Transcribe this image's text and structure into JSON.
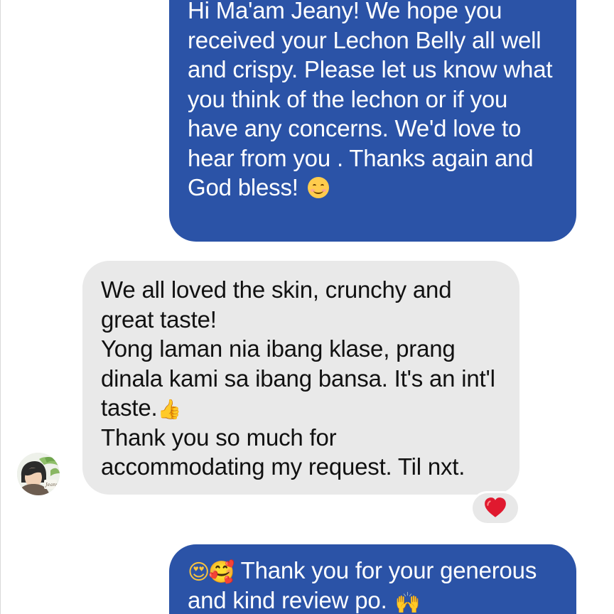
{
  "messages": {
    "outgoing_first": "Hi Ma'am Jeany! We hope you received your Lechon Belly all well and crispy. Please let us know what you think of the lechon or if you have any concerns. We'd love to hear from you . Thanks again and God bless! ",
    "incoming_reply": "We all loved the skin, crunchy and great taste!\nYong laman nia ibang klase, prang dinala kami sa ibang bansa. It's an int'l taste.",
    "incoming_reply_end": "\nThank you so much for accommodating my request. Til nxt.",
    "outgoing_second_text": " Thank you for your generous and kind review po. "
  },
  "emoji": {
    "smile": "😊",
    "thumbs_up": "👍",
    "heart_eyes": "😍",
    "smiling_hearts": "🥰",
    "raising_hands": "🙌",
    "heart_reaction": "❤"
  },
  "avatar": {
    "signature_text": "Jeany"
  },
  "colors": {
    "outgoing_bubble": "#2b53a7",
    "incoming_bubble": "#e9e9e9",
    "reaction_heart": "#e0192f"
  }
}
